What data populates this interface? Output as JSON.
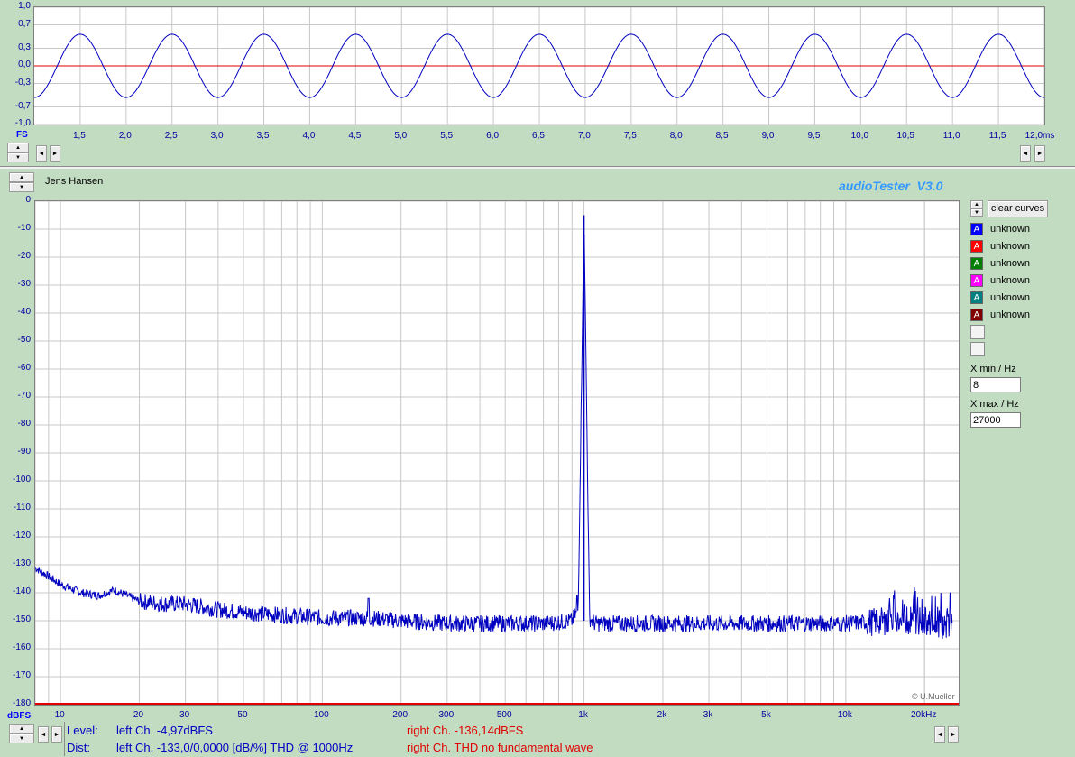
{
  "top_chart": {
    "x_unit_label": "FS",
    "x_ticks": [
      "1,5",
      "2,0",
      "2,5",
      "3,0",
      "3,5",
      "4,0",
      "4,5",
      "5,0",
      "5,5",
      "6,0",
      "6,5",
      "7,0",
      "7,5",
      "8,0",
      "8,5",
      "9,0",
      "9,5",
      "10,0",
      "10,5",
      "11,0",
      "11,5",
      "12,0ms"
    ],
    "y_ticks": [
      "1,0",
      "0,7",
      "0,3",
      "0,0",
      "-0,3",
      "-0,7",
      "-1,0"
    ]
  },
  "header": {
    "user_name": "Jens Hansen",
    "app_title": "audioTester  V3.0"
  },
  "main_chart": {
    "y_unit_label": "dBFS",
    "y_ticks": [
      "0",
      "-10",
      "-20",
      "-30",
      "-40",
      "-50",
      "-60",
      "-70",
      "-80",
      "-90",
      "-100",
      "-110",
      "-120",
      "-130",
      "-140",
      "-150",
      "-160",
      "-170",
      "-180"
    ],
    "x_ticks": [
      "10",
      "20",
      "30",
      "50",
      "100",
      "200",
      "300",
      "500",
      "1k",
      "2k",
      "3k",
      "5k",
      "10k",
      "20kHz"
    ],
    "credit": "© U.Mueller"
  },
  "side_panel": {
    "clear_label": "clear curves",
    "legend": [
      {
        "label": "unknown",
        "color": "#0000ff",
        "glyph": "A"
      },
      {
        "label": "unknown",
        "color": "#ff0000",
        "glyph": "A"
      },
      {
        "label": "unknown",
        "color": "#008000",
        "glyph": "A"
      },
      {
        "label": "unknown",
        "color": "#ff00ff",
        "glyph": "A"
      },
      {
        "label": "unknown",
        "color": "#008080",
        "glyph": "A"
      },
      {
        "label": "unknown",
        "color": "#800000",
        "glyph": "A"
      }
    ],
    "xmin_label": "X min / Hz",
    "xmin_value": "8",
    "xmax_label": "X max / Hz",
    "xmax_value": "27000"
  },
  "status": {
    "level_label": "Level:",
    "level_left": "left Ch. -4,97dBFS",
    "level_right": "right Ch. -136,14dBFS",
    "dist_label": "Dist:",
    "dist_left": "left Ch. -133,0/0,0000 [dB/%] THD @ 1000Hz",
    "dist_right": "right Ch. THD no fundamental wave"
  },
  "chart_data": [
    {
      "type": "line",
      "title": "",
      "xlabel": "",
      "ylabel": "",
      "xlim": [
        1.0,
        12.0
      ],
      "ylim": [
        -1.0,
        1.0
      ],
      "grid": true,
      "series": [
        {
          "color": "#0000c0",
          "values_description_free": true,
          "x_start": 1.0,
          "x_end": 12.0,
          "frequency_khz": 1.0,
          "amplitude": 0.54,
          "phase_peak_at_ms": 1.5
        },
        {
          "color": "#e00000",
          "constant": 0.0
        }
      ]
    },
    {
      "type": "line",
      "title": "",
      "xlabel": "",
      "ylabel": "",
      "x_scale": "log",
      "xlim": [
        8,
        27000
      ],
      "ylim": [
        -180,
        0
      ],
      "grid": true,
      "series": [
        {
          "color": "#0000c0",
          "x": [
            8,
            10,
            12,
            14,
            16,
            20,
            25,
            30,
            40,
            50,
            70,
            100,
            150,
            200,
            300,
            500,
            700,
            900,
            950,
            1000,
            1050,
            1100,
            1500,
            2000,
            3000,
            5000,
            7000,
            10000,
            15000,
            20000,
            25000
          ],
          "values": [
            -131,
            -137,
            -140,
            -141,
            -139,
            -143,
            -144,
            -144,
            -146,
            -147,
            -148,
            -149,
            -149,
            -150,
            -151,
            -151,
            -151,
            -150,
            -146,
            -5,
            -149,
            -151,
            -151,
            -151,
            -151,
            -151,
            -151,
            -151,
            -150,
            -150,
            -152
          ]
        },
        {
          "color": "#e00000",
          "constant": -180
        }
      ]
    }
  ]
}
